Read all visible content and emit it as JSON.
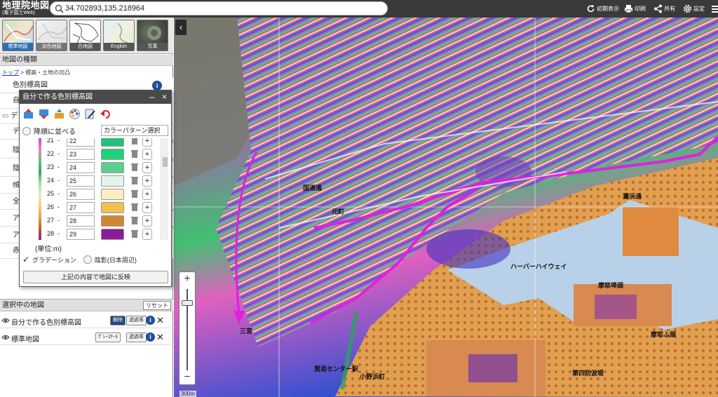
{
  "header": {
    "logo_main": "地理院地図",
    "logo_sub": "(電子国土Web)",
    "search_value": "34.702893,135.218964",
    "buttons": [
      "初期表示",
      "印刷",
      "共有",
      "設定"
    ]
  },
  "thumbnails": [
    {
      "label": "標準地図"
    },
    {
      "label": "淡色地図"
    },
    {
      "label": "白地図"
    },
    {
      "label": "English"
    },
    {
      "label": "写真"
    }
  ],
  "map_types": {
    "heading": "地図の種類",
    "breadcrumb_root": "トップ",
    "breadcrumb_rest": " > 標高・土地の凹凸",
    "items": [
      "色別標高図",
      "自",
      "デ",
      "デ",
      "陰",
      "陰",
      "傾",
      "全",
      "ア",
      "ア",
      "赤"
    ]
  },
  "popup": {
    "title": "自分で作る色別標高図",
    "minimize": "–",
    "close": "×",
    "sort_label": "降順に並べる",
    "pattern_label": "カラーパターン選択",
    "rows": [
      {
        "lo": "21",
        "hi": "22",
        "color": "#25c07a"
      },
      {
        "lo": "22",
        "hi": "23",
        "color": "#1fd07a"
      },
      {
        "lo": "23",
        "hi": "24",
        "color": "#5ccf8c"
      },
      {
        "lo": "24",
        "hi": "25",
        "color": "#e3f4ea"
      },
      {
        "lo": "25",
        "hi": "26",
        "color": "#fdeec4"
      },
      {
        "lo": "26",
        "hi": "27",
        "color": "#f0c050"
      },
      {
        "lo": "27",
        "hi": "28",
        "color": "#d08830"
      },
      {
        "lo": "28",
        "hi": "29",
        "color": "#8a1a9a"
      }
    ],
    "unit": "(単位:m)",
    "gradation_label": "グラデーション",
    "shade_label": "陰影(日本周辺)",
    "apply_label": "上記の内容で地図に反映"
  },
  "selected": {
    "heading": "選択中の地図",
    "reset": "リセット",
    "rows": [
      {
        "name": "自分で作る色別標高図",
        "btn1": "解除",
        "btn2": "透過率"
      },
      {
        "name": "標準地図",
        "btn1": "ｸﾞﾚｰｽｹｰﾙ",
        "btn2": "透過率"
      }
    ]
  },
  "map": {
    "collapse": "‹",
    "zoom_in": "+",
    "zoom_out": "−",
    "scale": "300m",
    "labels": [
      "国道通",
      "元町",
      "ハーバーハイウェイ",
      "摩耶埠頭",
      "摩耶ふ頭",
      "小野浜町",
      "貿易センター駅",
      "第四防波堤",
      "灘浜通",
      "三宮"
    ]
  },
  "colors": {
    "header_bg": "#3a3a3a",
    "info_blue": "#1f4e9c",
    "route_magenta": "#e020e0",
    "sea": "#b8d0e8"
  }
}
